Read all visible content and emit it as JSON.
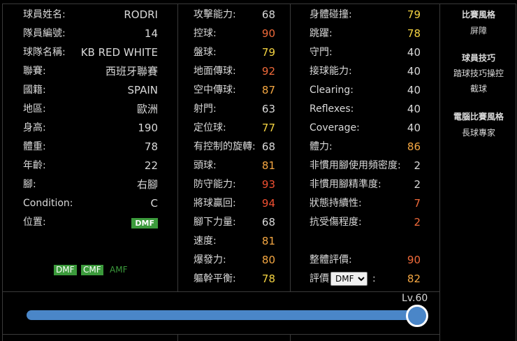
{
  "colors": {
    "yellow": "#f5d442",
    "orange": "#f5a742",
    "red": "#f06a3a",
    "redder": "#f05032",
    "normal": "#d9d9d9",
    "green": "#3b9a3b",
    "blue": "#4a86c8"
  },
  "profile": [
    {
      "label": "球員姓名:",
      "value": "RODRI"
    },
    {
      "label": "隊員編號:",
      "value": "14"
    },
    {
      "label": "球隊名稱:",
      "value": "KB RED WHITE"
    },
    {
      "label": "聯賽:",
      "value": "西班牙聯賽"
    },
    {
      "label": "國籍:",
      "value": "SPAIN"
    },
    {
      "label": "地區:",
      "value": "歐洲"
    },
    {
      "label": "身高:",
      "value": "190"
    },
    {
      "label": "體重:",
      "value": "78"
    },
    {
      "label": "年齡:",
      "value": "22"
    },
    {
      "label": "腳:",
      "value": "右腳"
    },
    {
      "label": "Condition:",
      "value": "C"
    },
    {
      "label": "位置:",
      "value": "DMF"
    }
  ],
  "positions": [
    {
      "label": "DMF",
      "state": "on"
    },
    {
      "label": "CMF",
      "state": "on"
    },
    {
      "label": "AMF",
      "state": "light"
    }
  ],
  "stats_a": [
    {
      "label": "攻擊能力:",
      "value": "68",
      "tone": "normal"
    },
    {
      "label": "控球:",
      "value": "90",
      "tone": "red"
    },
    {
      "label": "盤球:",
      "value": "79",
      "tone": "yellow"
    },
    {
      "label": "地面傳球:",
      "value": "92",
      "tone": "red"
    },
    {
      "label": "空中傳球:",
      "value": "87",
      "tone": "orange"
    },
    {
      "label": "射門:",
      "value": "63",
      "tone": "normal"
    },
    {
      "label": "定位球:",
      "value": "77",
      "tone": "yellow"
    },
    {
      "label": "有控制的旋轉:",
      "value": "68",
      "tone": "normal"
    },
    {
      "label": "頭球:",
      "value": "81",
      "tone": "orange"
    },
    {
      "label": "防守能力:",
      "value": "93",
      "tone": "redder"
    },
    {
      "label": "將球贏回:",
      "value": "94",
      "tone": "redder"
    },
    {
      "label": "腳下力量:",
      "value": "68",
      "tone": "normal"
    },
    {
      "label": "速度:",
      "value": "81",
      "tone": "orange"
    },
    {
      "label": "爆發力:",
      "value": "80",
      "tone": "orange"
    },
    {
      "label": "軀幹平衡:",
      "value": "78",
      "tone": "yellow"
    }
  ],
  "stats_b": [
    {
      "label": "身體碰撞:",
      "value": "79",
      "tone": "yellow"
    },
    {
      "label": "跳躍:",
      "value": "78",
      "tone": "yellow"
    },
    {
      "label": "守門:",
      "value": "40",
      "tone": "normal"
    },
    {
      "label": "接球能力:",
      "value": "40",
      "tone": "normal"
    },
    {
      "label": "Clearing:",
      "value": "40",
      "tone": "normal"
    },
    {
      "label": "Reflexes:",
      "value": "40",
      "tone": "normal"
    },
    {
      "label": "Coverage:",
      "value": "40",
      "tone": "normal"
    },
    {
      "label": "體力:",
      "value": "86",
      "tone": "orange"
    },
    {
      "label": "非慣用腳使用頻密度:",
      "value": "2",
      "tone": "normal"
    },
    {
      "label": "非慣用腳精準度:",
      "value": "2",
      "tone": "normal"
    },
    {
      "label": "狀態持續性:",
      "value": "7",
      "tone": "red"
    },
    {
      "label": "抗受傷程度:",
      "value": "2",
      "tone": "red"
    }
  ],
  "overall": {
    "label": "整體評價:",
    "value": "90",
    "tone": "red"
  },
  "rating": {
    "label": "評價",
    "select_value": "DMF",
    "suffix": ":",
    "value": "82",
    "tone": "orange"
  },
  "right": {
    "match_style_title": "比賽風格",
    "match_style": "屏障",
    "skills_title": "球員技巧",
    "skills": [
      "踏球技巧操控",
      "截球"
    ],
    "com_style_title": "電腦比賽風格",
    "com_style": "長球專家"
  },
  "level": {
    "label": "Lv.60",
    "value": 60,
    "max": 60
  }
}
